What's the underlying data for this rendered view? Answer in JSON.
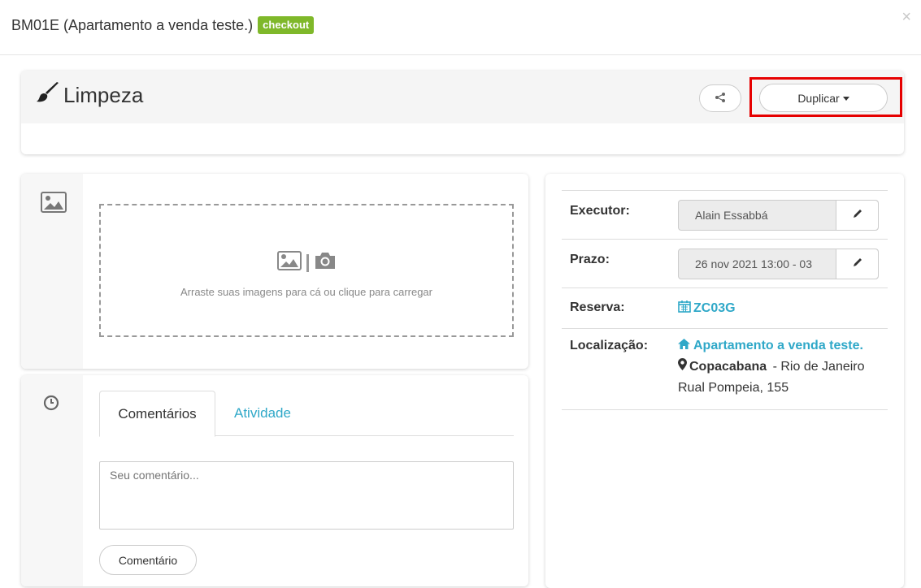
{
  "header": {
    "title": "BM01E (Apartamento a venda teste.)",
    "badge": "checkout",
    "close": "×"
  },
  "task": {
    "title": "Limpeza",
    "icon": "paintbrush-icon",
    "duplicate_label": "Duplicar"
  },
  "images": {
    "dropzone_text": "Arraste suas imagens para cá ou clique para carregar"
  },
  "comments": {
    "tabs": [
      "Comentários",
      "Atividade"
    ],
    "placeholder": "Seu comentário...",
    "submit_label": "Comentário"
  },
  "details": {
    "executor_label": "Executor:",
    "executor_value": "Alain Essabbá",
    "prazo_label": "Prazo:",
    "prazo_value": "26 nov 2021 13:00 - 03",
    "reserva_label": "Reserva:",
    "reserva_value": "ZC03G",
    "localizacao_label": "Localização:",
    "location_name": "Apartamento a venda teste.",
    "neighborhood": "Copacabana",
    "city": " - Rio de Janeiro",
    "address": "Rual Pompeia, 155"
  },
  "colors": {
    "accent": "#2fa8c8",
    "badge": "#7fb82a",
    "highlight": "#e60000"
  }
}
